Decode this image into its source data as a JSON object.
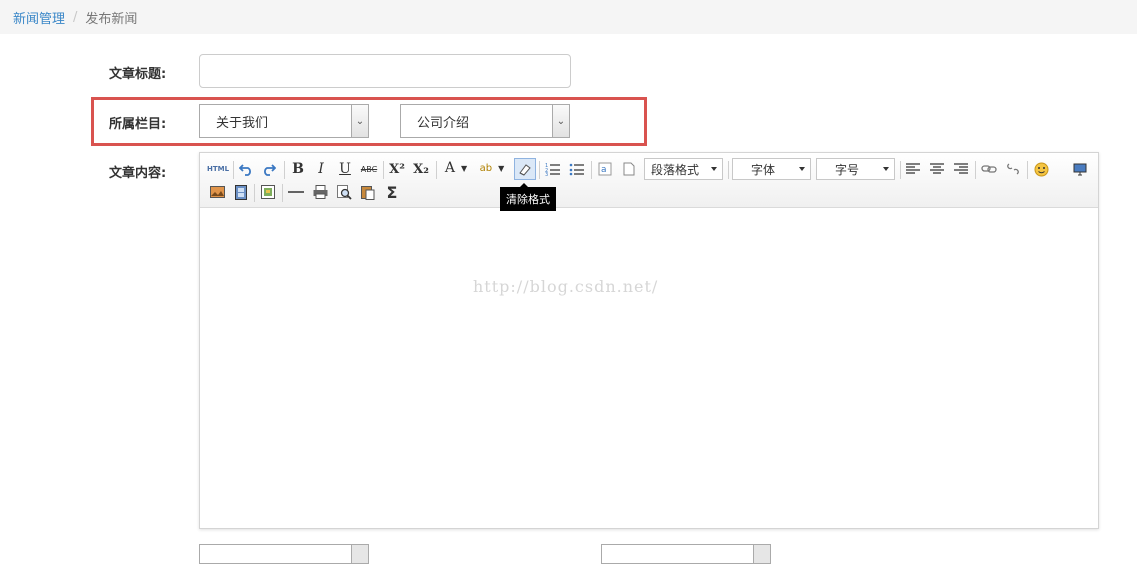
{
  "breadcrumb": {
    "parent": "新闻管理",
    "separator": "/",
    "current": "发布新闻"
  },
  "form": {
    "title_label": "文章标题:",
    "title_value": "",
    "category_label": "所属栏目:",
    "category_primary": "关于我们",
    "category_secondary": "公司介绍",
    "content_label": "文章内容:"
  },
  "editor": {
    "tooltip": "清除格式",
    "html_label": "HTML",
    "paragraph_label": "段落格式",
    "font_label": "字体",
    "size_label": "字号",
    "watermark": "http://blog.csdn.net/"
  },
  "colors": {
    "accent": "#3a87c8",
    "highlight": "#d9534f"
  }
}
